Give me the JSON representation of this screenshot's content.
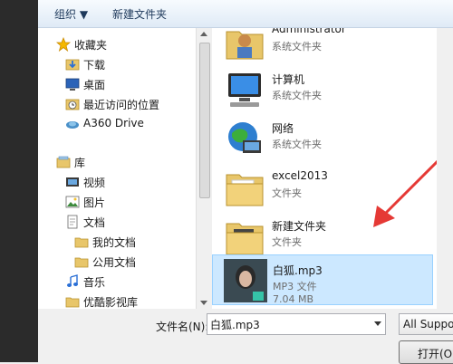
{
  "toolbar": {
    "organize": "组织 ▼",
    "new_folder": "新建文件夹"
  },
  "nav": {
    "favorites": "收藏夹",
    "downloads": "下载",
    "desktop": "桌面",
    "recent": "最近访问的位置",
    "a360": "A360 Drive",
    "libraries": "库",
    "videos": "视频",
    "pictures": "图片",
    "documents": "文档",
    "my_documents": "我的文档",
    "public_documents": "公用文档",
    "music": "音乐",
    "youku": "优酷影视库"
  },
  "files": [
    {
      "name": "Administrator",
      "type": "系统文件夹"
    },
    {
      "name": "计算机",
      "type": "系统文件夹"
    },
    {
      "name": "网络",
      "type": "系统文件夹"
    },
    {
      "name": "excel2013",
      "type": "文件夹"
    },
    {
      "name": "新建文件夹",
      "type": "文件夹"
    },
    {
      "name": "白狐.mp3",
      "type": "MP3 文件",
      "size": "7.04 MB"
    }
  ],
  "bottom": {
    "filename_label": "文件名(N):",
    "filename_value": "白狐.mp3",
    "filter": "All Suppor",
    "open": "打开(O)"
  },
  "colors": {
    "selection": "#cce8ff",
    "arrow": "#e53935"
  }
}
